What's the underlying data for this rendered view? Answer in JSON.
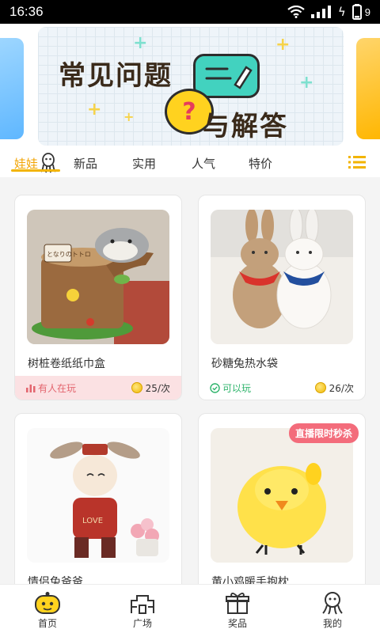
{
  "status_bar": {
    "time": "16:36",
    "battery_level": "9"
  },
  "banner": {
    "title_line1": "常见问题",
    "title_line2": "与解答",
    "question_mark": "?"
  },
  "tabs": [
    {
      "label": "娃娃",
      "active": true
    },
    {
      "label": "新品",
      "active": false
    },
    {
      "label": "实用",
      "active": false
    },
    {
      "label": "人气",
      "active": false
    },
    {
      "label": "特价",
      "active": false
    }
  ],
  "products": [
    {
      "name": "树桩卷纸纸巾盒",
      "status": "有人在玩",
      "status_type": "playing",
      "price": "25/次",
      "image_label": "となりのトトロ"
    },
    {
      "name": "砂糖兔热水袋",
      "status": "可以玩",
      "status_type": "available",
      "price": "26/次"
    },
    {
      "name": "情侣兔爸爸",
      "image_label": "LOVE"
    },
    {
      "name": "黄小鸡暖手抱枕",
      "badge": "直播限时秒杀"
    }
  ],
  "bottom_nav": [
    {
      "label": "首页",
      "icon": "home-robot-icon"
    },
    {
      "label": "广场",
      "icon": "plaza-icon"
    },
    {
      "label": "奖品",
      "icon": "gift-icon"
    },
    {
      "label": "我的",
      "icon": "octopus-icon"
    }
  ],
  "colors": {
    "accent": "#f2b400",
    "playing": "#e3656e",
    "available": "#2fb46c"
  }
}
